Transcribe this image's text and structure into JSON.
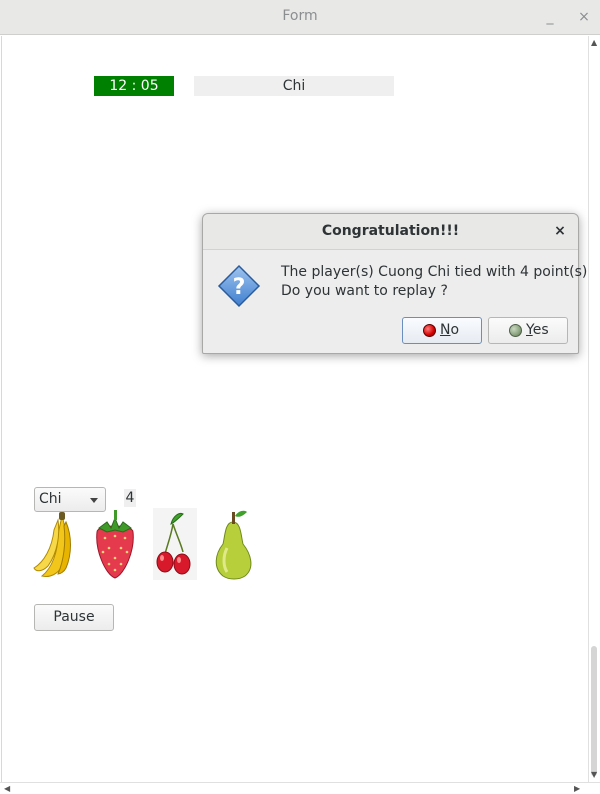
{
  "window": {
    "title": "Form",
    "minimize_glyph": "_",
    "close_glyph": "×"
  },
  "game": {
    "timer": "12 : 05",
    "timer_color": "#008000",
    "current_player": "Chi",
    "player_select": {
      "selected": "Chi"
    },
    "score": "4",
    "fruits": [
      "banana-icon",
      "strawberry-icon",
      "cherry-icon",
      "pear-icon"
    ],
    "pause_label": "Pause"
  },
  "dialog": {
    "title": "Congratulation!!!",
    "close_glyph": "×",
    "icon": "question-icon",
    "message_line1": "The player(s) Cuong Chi tied with 4 point(s)",
    "message_line2": "Do you want to replay ?",
    "no_label": {
      "mnemonic": "N",
      "rest": "o"
    },
    "yes_label": {
      "mnemonic": "Y",
      "rest": "es"
    }
  }
}
